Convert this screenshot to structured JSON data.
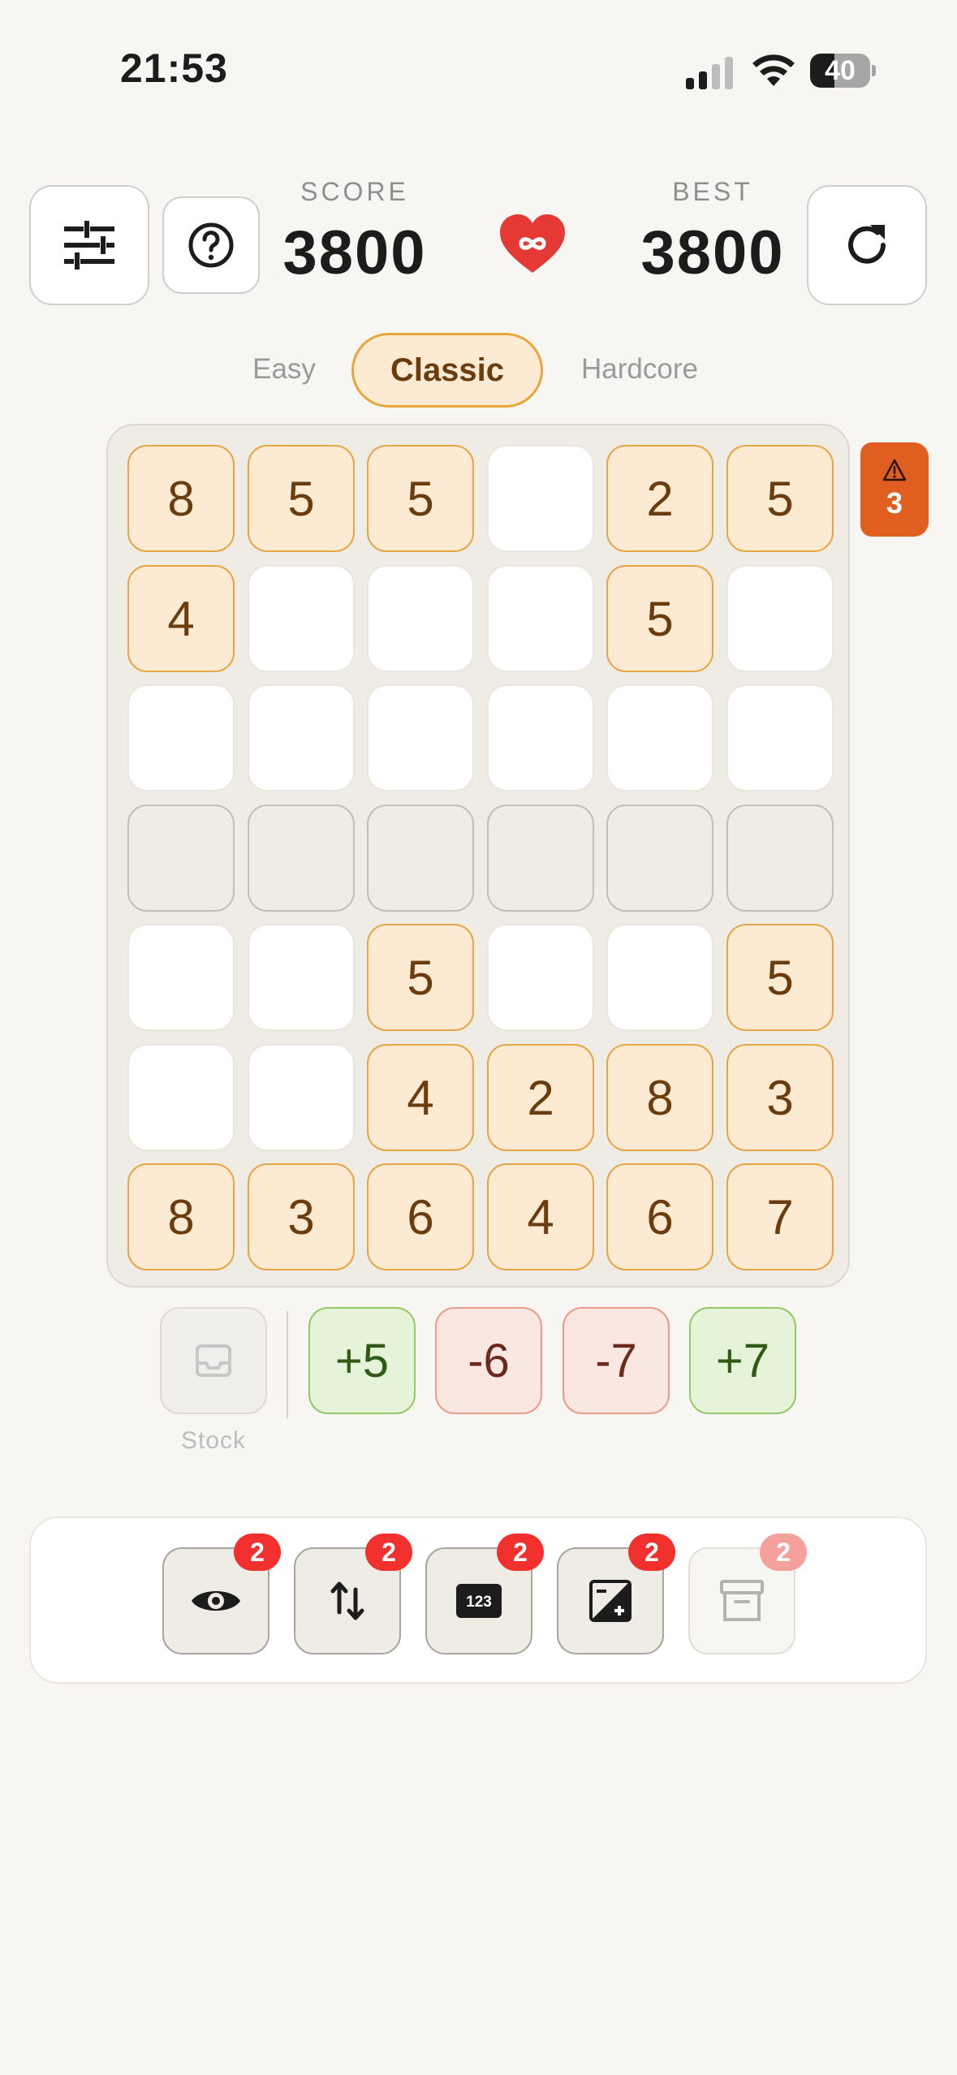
{
  "status_bar": {
    "time": "21:53",
    "battery": "40",
    "battery_level": 0.4
  },
  "header": {
    "score_label": "SCORE",
    "score_value": "3800",
    "best_label": "BEST",
    "best_value": "3800",
    "lives_icon": "heart-infinity-icon"
  },
  "tabs": [
    {
      "label": "Easy",
      "selected": false
    },
    {
      "label": "Classic",
      "selected": true
    },
    {
      "label": "Hardcore",
      "selected": false
    }
  ],
  "board": {
    "rows": [
      [
        {
          "v": "8",
          "s": "tile"
        },
        {
          "v": "5",
          "s": "tile"
        },
        {
          "v": "5",
          "s": "tile"
        },
        {
          "v": "",
          "s": "empty"
        },
        {
          "v": "2",
          "s": "tile"
        },
        {
          "v": "5",
          "s": "tile"
        }
      ],
      [
        {
          "v": "4",
          "s": "tile"
        },
        {
          "v": "",
          "s": "empty"
        },
        {
          "v": "",
          "s": "empty"
        },
        {
          "v": "",
          "s": "empty"
        },
        {
          "v": "5",
          "s": "tile"
        },
        {
          "v": "",
          "s": "empty"
        }
      ],
      [
        {
          "v": "",
          "s": "empty"
        },
        {
          "v": "",
          "s": "empty"
        },
        {
          "v": "",
          "s": "empty"
        },
        {
          "v": "",
          "s": "empty"
        },
        {
          "v": "",
          "s": "empty"
        },
        {
          "v": "",
          "s": "empty"
        }
      ],
      [
        {
          "v": "",
          "s": "gray"
        },
        {
          "v": "",
          "s": "gray"
        },
        {
          "v": "",
          "s": "gray"
        },
        {
          "v": "",
          "s": "gray"
        },
        {
          "v": "",
          "s": "gray"
        },
        {
          "v": "",
          "s": "gray"
        }
      ],
      [
        {
          "v": "",
          "s": "empty"
        },
        {
          "v": "",
          "s": "empty"
        },
        {
          "v": "5",
          "s": "tile"
        },
        {
          "v": "",
          "s": "empty"
        },
        {
          "v": "",
          "s": "empty"
        },
        {
          "v": "5",
          "s": "tile"
        }
      ],
      [
        {
          "v": "",
          "s": "empty"
        },
        {
          "v": "",
          "s": "empty"
        },
        {
          "v": "4",
          "s": "tile"
        },
        {
          "v": "2",
          "s": "tile"
        },
        {
          "v": "8",
          "s": "tile"
        },
        {
          "v": "3",
          "s": "tile"
        }
      ],
      [
        {
          "v": "8",
          "s": "tile"
        },
        {
          "v": "3",
          "s": "tile"
        },
        {
          "v": "6",
          "s": "tile"
        },
        {
          "v": "4",
          "s": "tile"
        },
        {
          "v": "6",
          "s": "tile"
        },
        {
          "v": "7",
          "s": "tile"
        }
      ]
    ]
  },
  "warning": {
    "icon": "warning-icon",
    "count": "3"
  },
  "stock": {
    "label": "Stock",
    "icon": "inbox-icon"
  },
  "cards": [
    {
      "label": "+5",
      "kind": "pos"
    },
    {
      "label": "-6",
      "kind": "neg"
    },
    {
      "label": "-7",
      "kind": "neg"
    },
    {
      "label": "+7",
      "kind": "pos"
    }
  ],
  "powerups": [
    {
      "name": "peek",
      "icon": "eye-icon",
      "count": "2",
      "enabled": true
    },
    {
      "name": "swap",
      "icon": "swap-arrows-icon",
      "count": "2",
      "enabled": true
    },
    {
      "name": "numbers",
      "icon": "numbers-123-icon",
      "count": "2",
      "enabled": true
    },
    {
      "name": "plus-minus",
      "icon": "plus-minus-icon",
      "count": "2",
      "enabled": true
    },
    {
      "name": "archive",
      "icon": "archive-icon",
      "count": "2",
      "enabled": false
    }
  ],
  "colors": {
    "background": "#f8f6f2",
    "tile": "#fcebd2",
    "tile_border": "#e6a645",
    "tile_text": "#6b3d0e",
    "accent_orange": "#e05e20",
    "heart": "#e53935",
    "badge_red": "#f2312e"
  }
}
